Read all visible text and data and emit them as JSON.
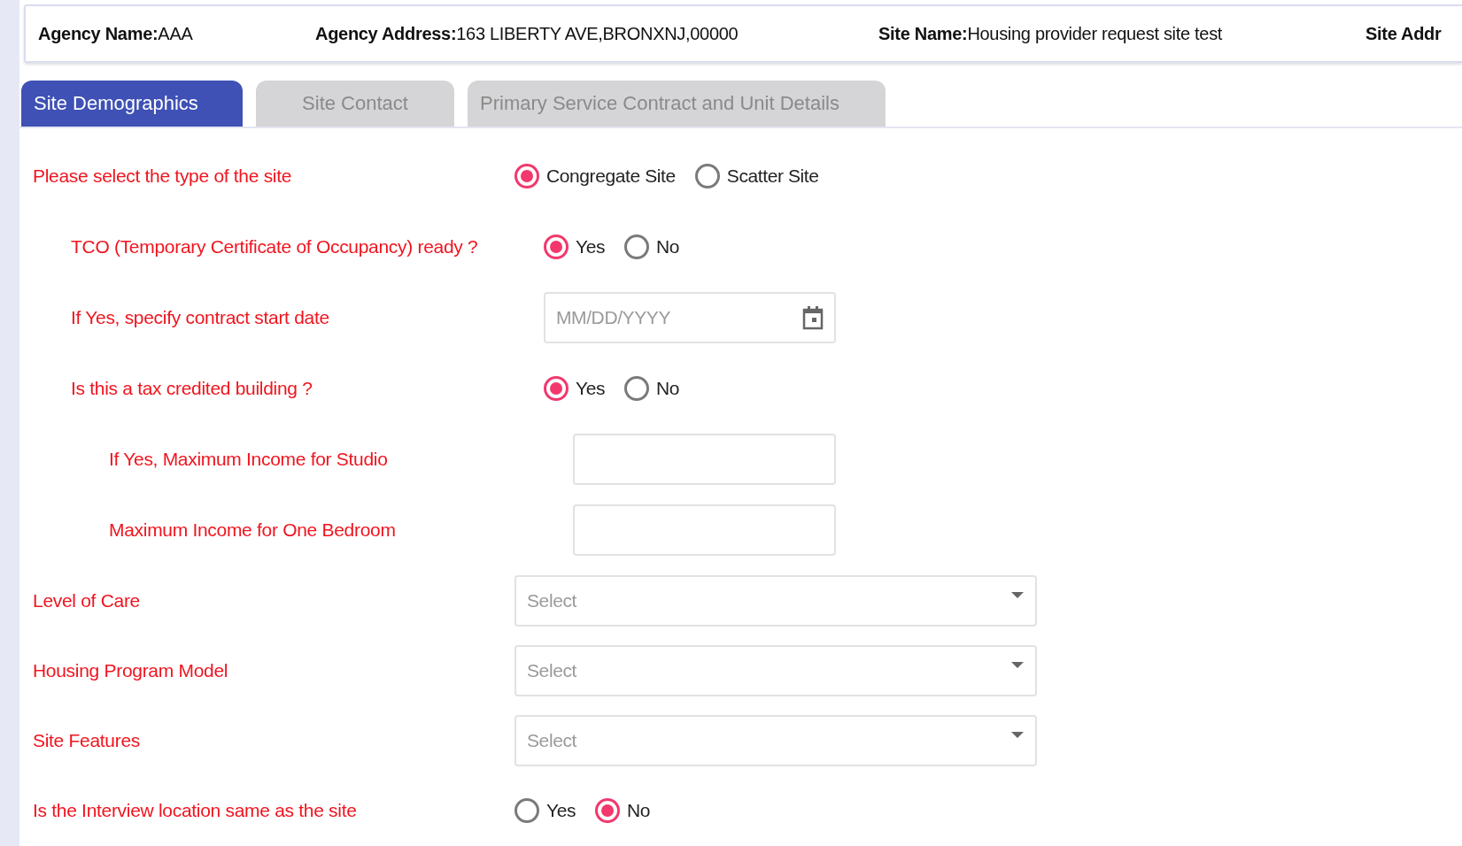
{
  "header": [
    {
      "label": "Agency Name:",
      "value": "AAA"
    },
    {
      "label": "Agency Address:",
      "value": "163 LIBERTY AVE,BRONXNJ,00000"
    },
    {
      "label": "Site Name:",
      "value": "Housing provider request site test"
    },
    {
      "label": "Site Addr"
    }
  ],
  "tabs": [
    {
      "label": "Site Demographics",
      "selected": true
    },
    {
      "label": "Site Contact",
      "selected": false
    },
    {
      "label": "Primary Service Contract and Unit Details",
      "selected": false
    }
  ],
  "form": [
    {
      "kind": "radio",
      "label": "Please select the type of the site",
      "options": [
        {
          "label": "Congregate Site",
          "selected": true
        },
        {
          "label": "Scatter Site",
          "selected": false
        }
      ],
      "children": [
        {
          "kind": "radio",
          "label": "TCO (Temporary Certificate of Occupancy) ready ?",
          "options": [
            {
              "label": "Yes",
              "selected": true
            },
            {
              "label": "No",
              "selected": false
            }
          ]
        },
        {
          "kind": "date",
          "label": "If Yes, specify contract start date",
          "placeholder": "MM/DD/YYYY"
        },
        {
          "kind": "radio",
          "label": "Is this a tax credited building ?",
          "options": [
            {
              "label": "Yes",
              "selected": true
            },
            {
              "label": "No",
              "selected": false
            }
          ],
          "children": [
            {
              "kind": "text",
              "label": "If Yes, Maximum Income for Studio"
            },
            {
              "kind": "text",
              "label": "Maximum Income for One Bedroom"
            }
          ]
        }
      ]
    },
    {
      "kind": "select",
      "label": "Level of Care",
      "placeholder": "Select"
    },
    {
      "kind": "select",
      "label": "Housing Program Model",
      "placeholder": "Select"
    },
    {
      "kind": "select",
      "label": "Site Features",
      "placeholder": "Select"
    },
    {
      "kind": "radio",
      "label": "Is the Interview location same as the site",
      "options": [
        {
          "label": "Yes",
          "selected": false
        },
        {
          "label": "No",
          "selected": true
        }
      ]
    }
  ]
}
